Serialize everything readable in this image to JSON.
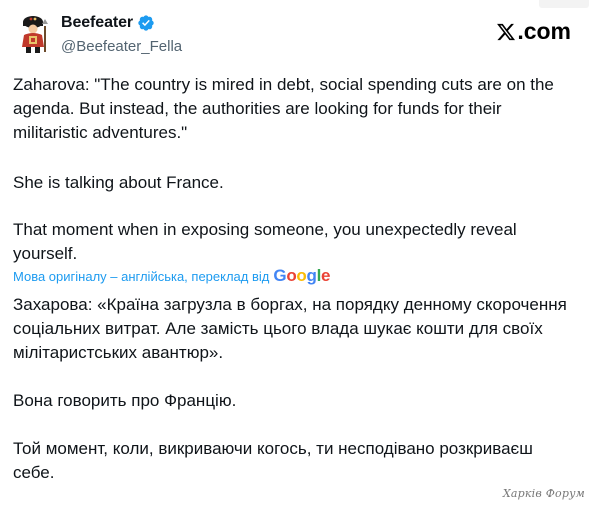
{
  "author": {
    "display_name": "Beefeater",
    "handle": "@Beefeater_Fella",
    "avatar_icon": "beefeater-guard-icon",
    "verified_icon": "verified-badge-icon"
  },
  "brand": {
    "logo_icon": "x-logo-icon",
    "logo_text": ".com"
  },
  "tweet": {
    "original_paragraphs": [
      "Zaharova: \"The country is mired in debt, social spending cuts are on the agenda. But instead, the authorities are looking for funds for their militaristic adventures.\"",
      "She is talking about France.",
      "That moment when in exposing someone, you unexpectedly reveal yourself."
    ],
    "translation_label": "Мова оригіналу – англійська, переклад від",
    "translation_provider": "Google",
    "translated_paragraphs": [
      "Захарова: «Країна загрузла в боргах, на порядку денному скорочення соціальних витрат. Але замість цього влада шукає кошти для своїх мілітаристських авантюр».",
      "Вона говорить про Францію.",
      "Той момент, коли, викриваючи когось, ти несподівано розкриваєш себе."
    ]
  },
  "watermark": "Харків Форум",
  "colors": {
    "text": "#0f1419",
    "secondary": "#536471",
    "link": "#1d9bf0",
    "verified": "#1d9bf0"
  }
}
